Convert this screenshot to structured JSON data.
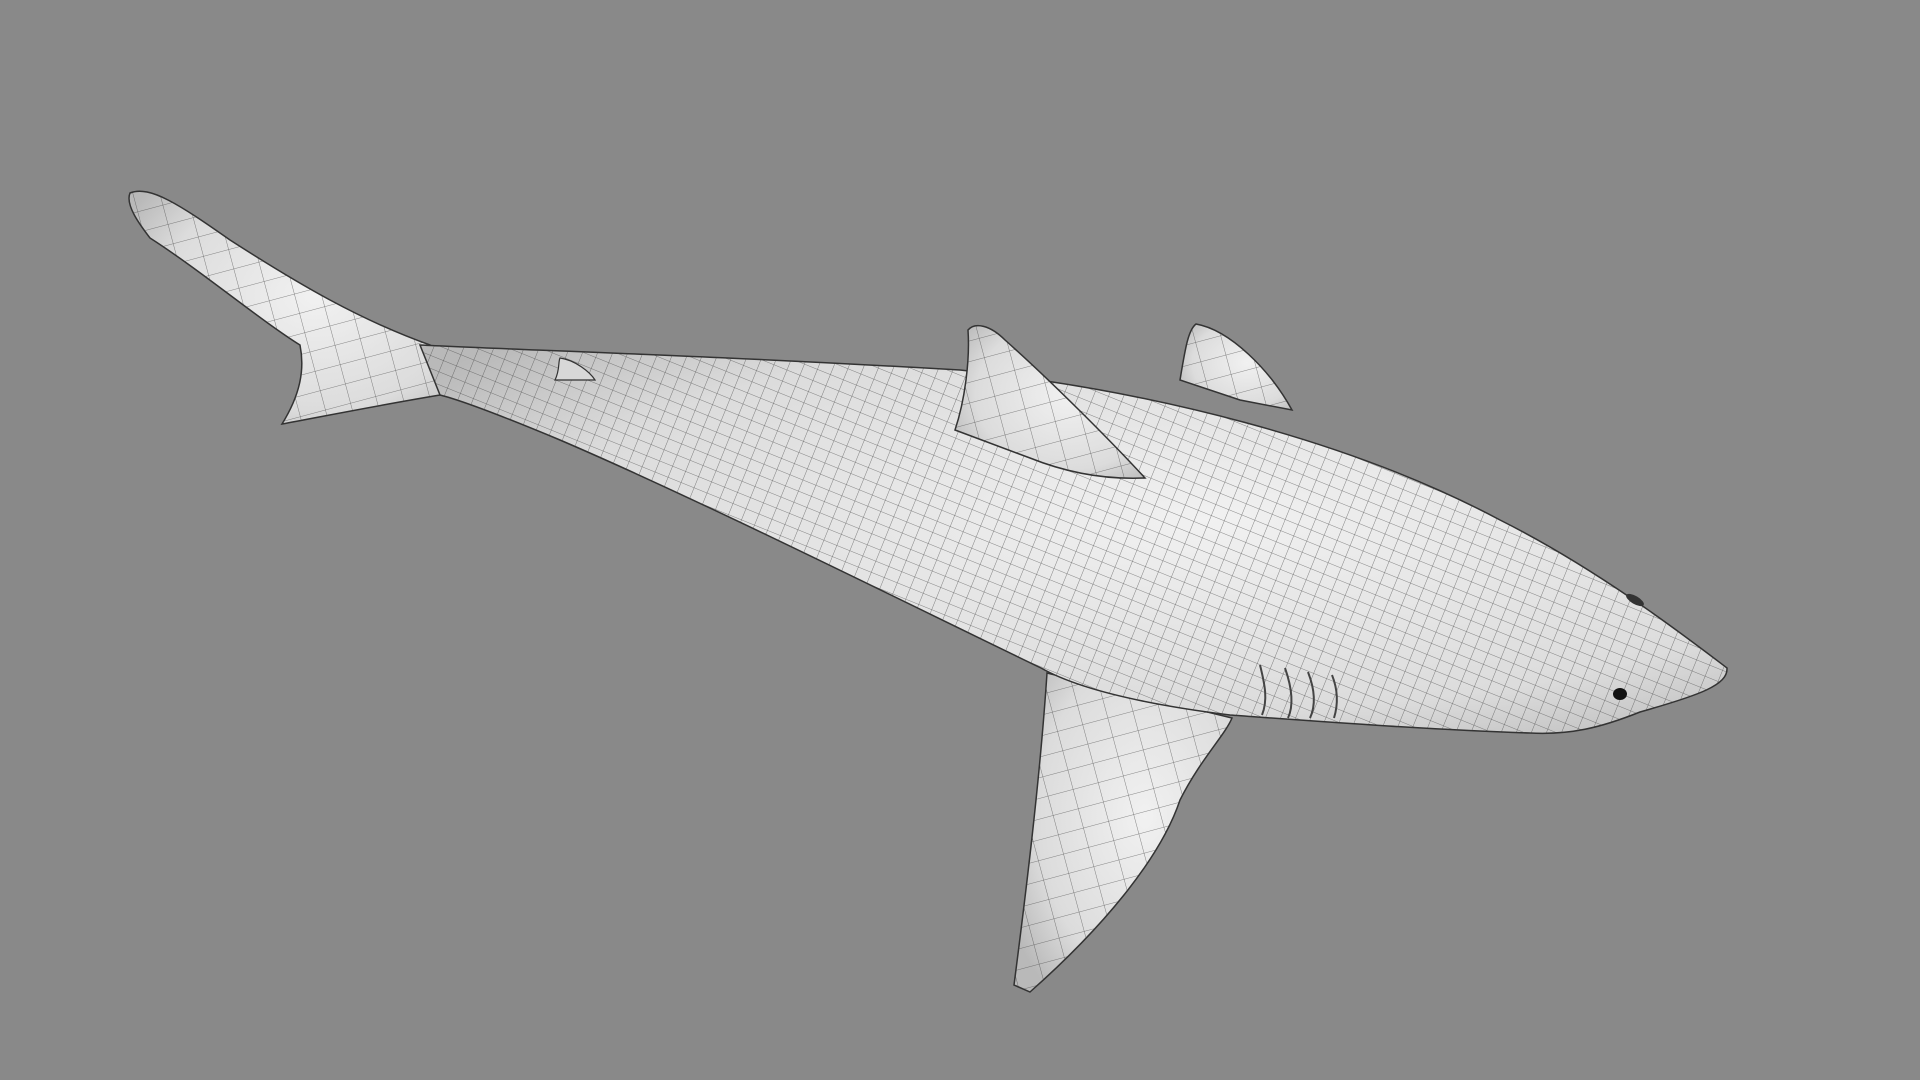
{
  "scene": {
    "subject": "shark",
    "colors": {
      "background": "#898989",
      "surface": "#e6e6e6",
      "wire": "#3a3a3a"
    }
  }
}
